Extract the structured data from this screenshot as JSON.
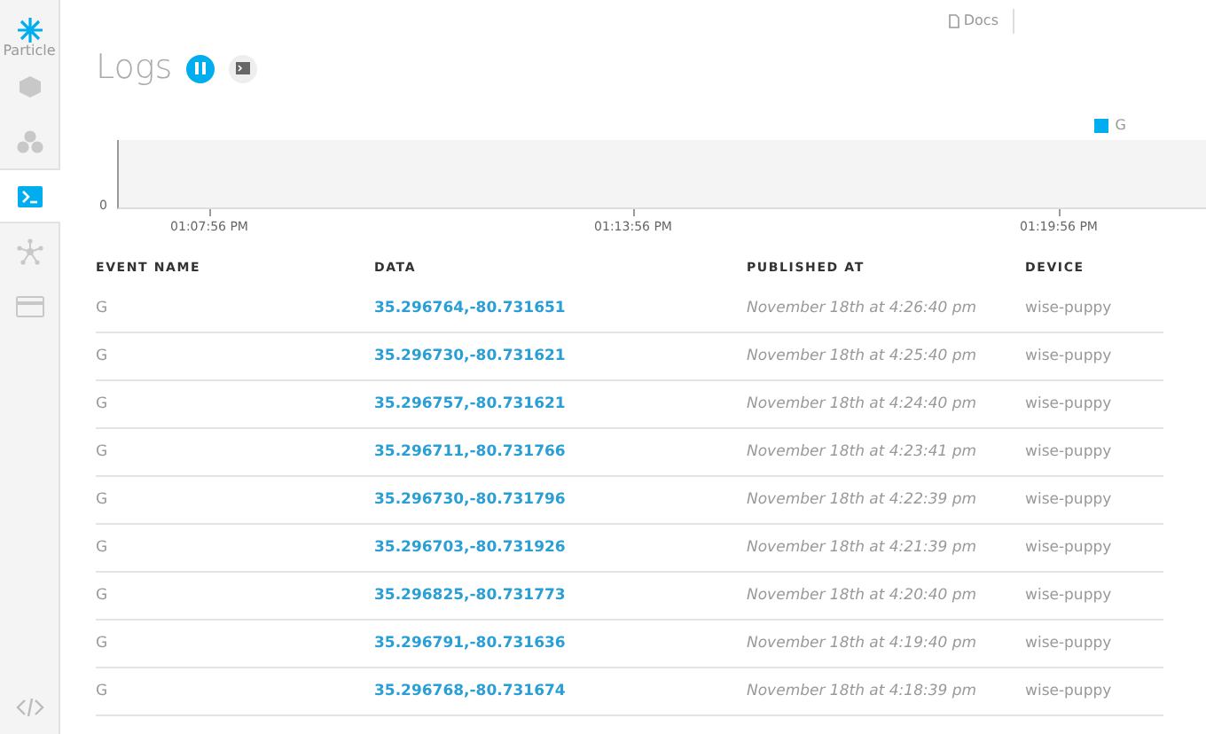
{
  "sidebar": {
    "brand": "Particle",
    "items": [
      {
        "kind": "cube",
        "selected": false
      },
      {
        "kind": "cubes",
        "selected": false
      },
      {
        "kind": "terminal",
        "selected": true
      },
      {
        "kind": "network",
        "selected": false
      },
      {
        "kind": "card",
        "selected": false
      }
    ],
    "footer_items": [
      {
        "kind": "code"
      }
    ]
  },
  "top_bar": {
    "docs_link": "Docs"
  },
  "title": "Logs",
  "chart": {
    "legend": [
      {
        "label": "G",
        "color": "#00aeef"
      }
    ],
    "y_tick": "0",
    "x_ticks": [
      "01:07:56 PM",
      "01:13:56 PM",
      "01:19:56 PM"
    ]
  },
  "table": {
    "columns": [
      "EVENT NAME",
      "DATA",
      "PUBLISHED AT",
      "DEVICE"
    ],
    "rows": [
      {
        "event": "G",
        "data": "35.296764,-80.731651",
        "published": "November 18th at 4:26:40 pm",
        "device": "wise-puppy"
      },
      {
        "event": "G",
        "data": "35.296730,-80.731621",
        "published": "November 18th at 4:25:40 pm",
        "device": "wise-puppy"
      },
      {
        "event": "G",
        "data": "35.296757,-80.731621",
        "published": "November 18th at 4:24:40 pm",
        "device": "wise-puppy"
      },
      {
        "event": "G",
        "data": "35.296711,-80.731766",
        "published": "November 18th at 4:23:41 pm",
        "device": "wise-puppy"
      },
      {
        "event": "G",
        "data": "35.296730,-80.731796",
        "published": "November 18th at 4:22:39 pm",
        "device": "wise-puppy"
      },
      {
        "event": "G",
        "data": "35.296703,-80.731926",
        "published": "November 18th at 4:21:39 pm",
        "device": "wise-puppy"
      },
      {
        "event": "G",
        "data": "35.296825,-80.731773",
        "published": "November 18th at 4:20:40 pm",
        "device": "wise-puppy"
      },
      {
        "event": "G",
        "data": "35.296791,-80.731636",
        "published": "November 18th at 4:19:40 pm",
        "device": "wise-puppy"
      },
      {
        "event": "G",
        "data": "35.296768,-80.731674",
        "published": "November 18th at 4:18:39 pm",
        "device": "wise-puppy"
      }
    ]
  }
}
